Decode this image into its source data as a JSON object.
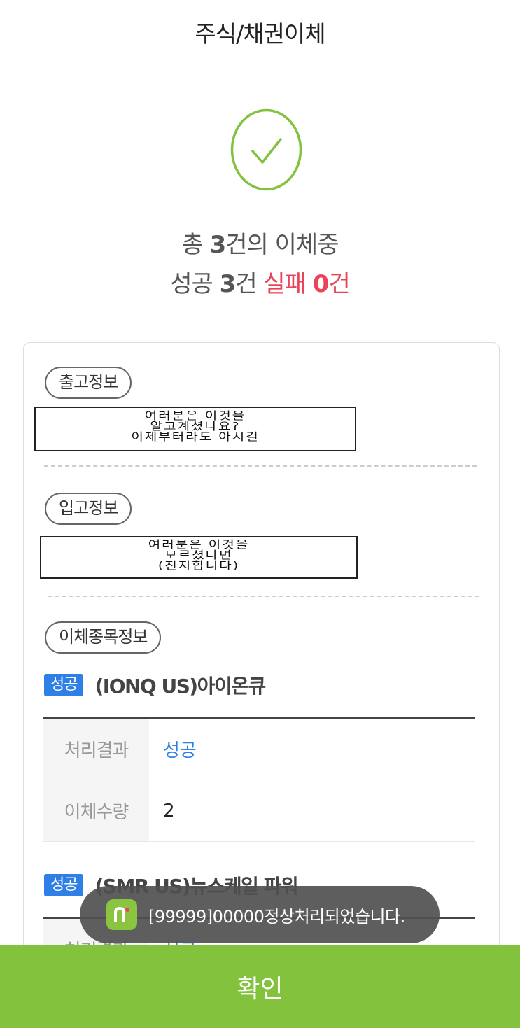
{
  "header": {
    "title": "주식/채권이체"
  },
  "summary": {
    "total_prefix": "총 ",
    "total_count": "3",
    "total_suffix": "건의 이체중",
    "success_prefix": "성공 ",
    "success_count": "3",
    "success_suffix": "건",
    "fail_prefix": "실패 ",
    "fail_count": "0",
    "fail_suffix": "건"
  },
  "sections": {
    "outgoing_label": "출고정보",
    "incoming_label": "입고정보",
    "items_label": "이체종목정보"
  },
  "censor_note": {
    "line1": "여러분은 이것을",
    "line2": "알고계셨나요?",
    "line3": "모르셨다면",
    "line4": "이제부터라도 아시길",
    "line5": "(진지합니다)"
  },
  "stocks": [
    {
      "badge": "성공",
      "name": "(IONQ US)아이온큐",
      "rows": [
        {
          "label": "처리결과",
          "value": "성공"
        },
        {
          "label": "이체수량",
          "value": "2"
        }
      ]
    },
    {
      "badge": "성공",
      "name": "(SMR US)뉴스케일 파워",
      "rows": [
        {
          "label": "처리결과",
          "value": "성공"
        }
      ]
    }
  ],
  "toast": {
    "message": "[99999]00000정상처리되었습니다."
  },
  "footer": {
    "confirm_label": "확인"
  },
  "colors": {
    "accent_green": "#82c23c",
    "success_blue": "#2f80e6",
    "fail_red": "#e8445a"
  }
}
